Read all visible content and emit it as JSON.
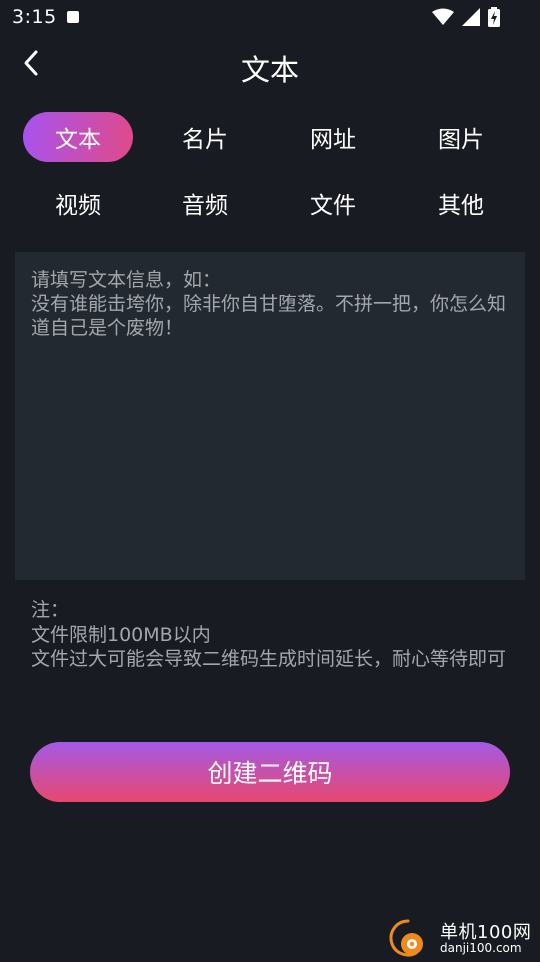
{
  "status_bar": {
    "time": "3:15"
  },
  "header": {
    "title": "文本"
  },
  "tabs": [
    {
      "label": "文本",
      "active": true
    },
    {
      "label": "名片",
      "active": false
    },
    {
      "label": "网址",
      "active": false
    },
    {
      "label": "图片",
      "active": false
    },
    {
      "label": "视频",
      "active": false
    },
    {
      "label": "音频",
      "active": false
    },
    {
      "label": "文件",
      "active": false
    },
    {
      "label": "其他",
      "active": false
    }
  ],
  "text_input": {
    "value": "",
    "placeholder": "请填写文本信息，如：\n没有谁能击垮你，除非你自甘堕落。不拼一把，你怎么知道自己是个废物！"
  },
  "note": {
    "lines": [
      "注：",
      "文件限制100MB以内",
      "文件过大可能会导致二维码生成时间延长，耐心等待即可"
    ]
  },
  "create_button": {
    "label": "创建二维码"
  },
  "watermark": {
    "name": "单机100网",
    "domain": "danji100.com"
  },
  "colors": {
    "background": "#181c22",
    "panel": "#232930",
    "accent_start": "#a653f0",
    "accent_end": "#e14a87",
    "muted_text": "#a3a6ab"
  }
}
